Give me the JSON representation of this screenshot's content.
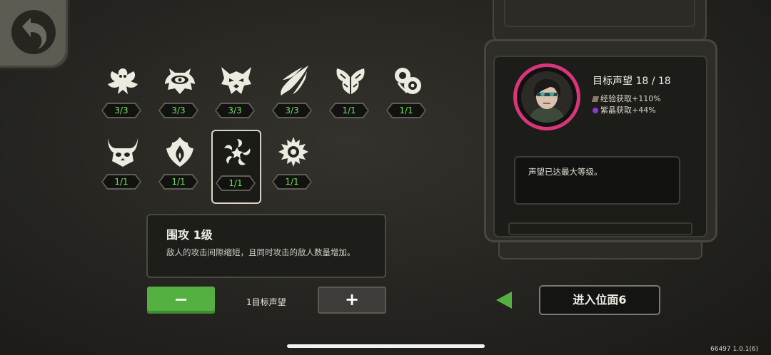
{
  "back_button": {
    "icon": "back-arrow-icon"
  },
  "skills": [
    {
      "name": "skill-1",
      "icon": "beast-crest-icon",
      "count": "3/3"
    },
    {
      "name": "skill-2",
      "icon": "eye-mask-icon",
      "count": "3/3"
    },
    {
      "name": "skill-3",
      "icon": "demon-mask-icon",
      "count": "3/3"
    },
    {
      "name": "skill-4",
      "icon": "claw-slash-icon",
      "count": "3/3"
    },
    {
      "name": "skill-5",
      "icon": "twin-horns-icon",
      "count": "1/1"
    },
    {
      "name": "skill-6",
      "icon": "swirl-orbs-icon",
      "count": "1/1"
    },
    {
      "name": "skill-7",
      "icon": "horned-skull-icon",
      "count": "1/1"
    },
    {
      "name": "skill-8",
      "icon": "flame-crest-icon",
      "count": "1/1"
    },
    {
      "name": "skill-9",
      "icon": "siege-star-icon",
      "count": "1/1",
      "selected": true
    },
    {
      "name": "skill-10",
      "icon": "spiked-orb-icon",
      "count": "1/1"
    }
  ],
  "detail": {
    "title": "围攻 1级",
    "description": "敌人的攻击间隙缩短，且同时攻击的敌人数量增加。"
  },
  "controls": {
    "minus_label": "−",
    "plus_label": "+",
    "target_label": "1目标声望"
  },
  "reputation": {
    "title": "目标声望 18 / 18",
    "exp_bonus": "经验获取+110%",
    "crystal_bonus": "紫晶获取+44%",
    "max_message": "声望已达最大等级。",
    "ring_color": "#d9357a"
  },
  "enter_button": {
    "label": "进入位面6"
  },
  "version": "66497 1.0.1(6)",
  "colors": {
    "count_text": "#6ee05a",
    "minus_bg": "#54b040",
    "arrow": "#54b040"
  }
}
